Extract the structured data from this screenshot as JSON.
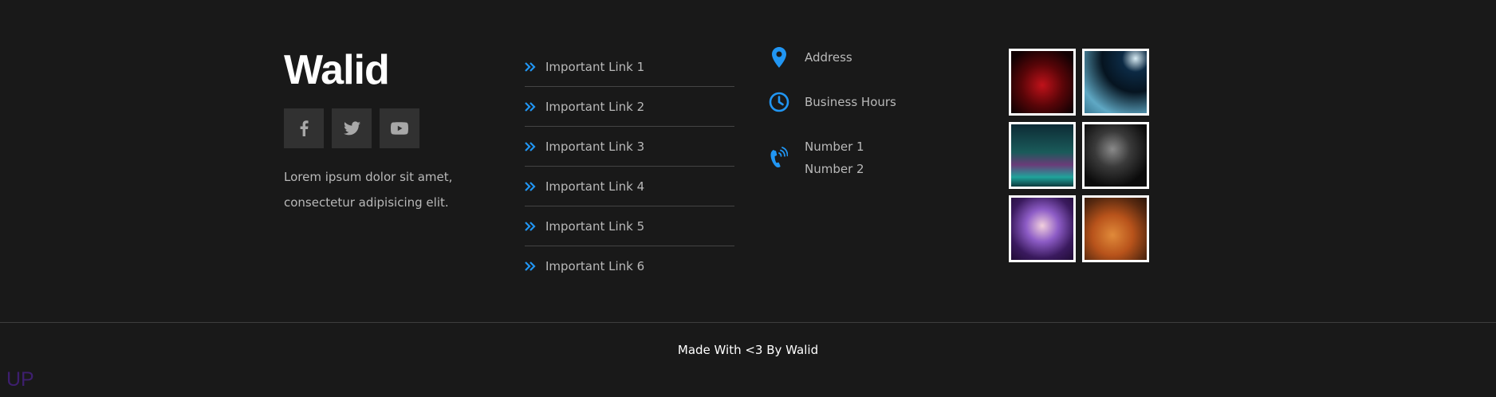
{
  "brand": {
    "name": "Walid"
  },
  "socials": [
    {
      "icon": "facebook-icon"
    },
    {
      "icon": "twitter-icon"
    },
    {
      "icon": "youtube-icon"
    }
  ],
  "about": {
    "line1": "Lorem ipsum dolor sit amet,",
    "line2": "consectetur adipisicing elit."
  },
  "links": [
    "Important Link 1",
    "Important Link 2",
    "Important Link 3",
    "Important Link 4",
    "Important Link 5",
    "Important Link 6"
  ],
  "contact": {
    "address": "Address",
    "hours": "Business Hours",
    "numbers": [
      "Number 1",
      "Number 2"
    ]
  },
  "gallery": [
    {
      "alt": "gallery-image-1"
    },
    {
      "alt": "gallery-image-2"
    },
    {
      "alt": "gallery-image-3"
    },
    {
      "alt": "gallery-image-4"
    },
    {
      "alt": "gallery-image-5"
    },
    {
      "alt": "gallery-image-6"
    }
  ],
  "copyright": "Made With <3 By Walid",
  "up_button": "UP",
  "colors": {
    "background": "#191919",
    "accent": "#2196f3",
    "social_bg": "#313131",
    "divider": "#3d3d3d",
    "up": "#3d1f6e"
  }
}
